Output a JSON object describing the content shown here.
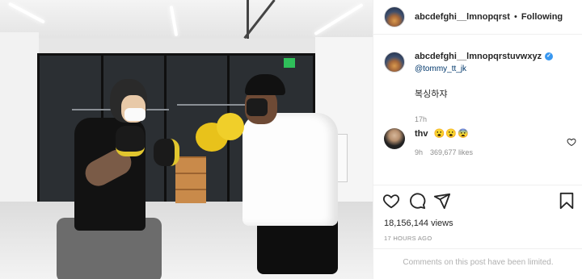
{
  "post": {
    "username": "abcdefghi__lmnopqrst",
    "separator": "•",
    "follow_label": "Following"
  },
  "caption": {
    "username": "abcdefghi__lmnopqrstuvwxyz",
    "verified_icon": "verified-check-icon",
    "mention": "@tommy_tt_jk",
    "text": "복싱하쟈",
    "time": "17h"
  },
  "comment": {
    "username": "thv",
    "text": "😮😮😨",
    "time": "9h",
    "likes": "369,677 likes"
  },
  "stats": {
    "views": "18,156,144 views",
    "posted_ago": "17 HOURS AGO"
  },
  "footer": {
    "limited_notice": "Comments on this post have been limited."
  },
  "icons": {
    "like": "heart-icon",
    "comment": "comment-bubble-icon",
    "share": "paper-plane-icon",
    "save": "bookmark-icon"
  },
  "colors": {
    "verified": "#3897f0",
    "mention": "#00376b",
    "muted": "#8e8e8e"
  }
}
